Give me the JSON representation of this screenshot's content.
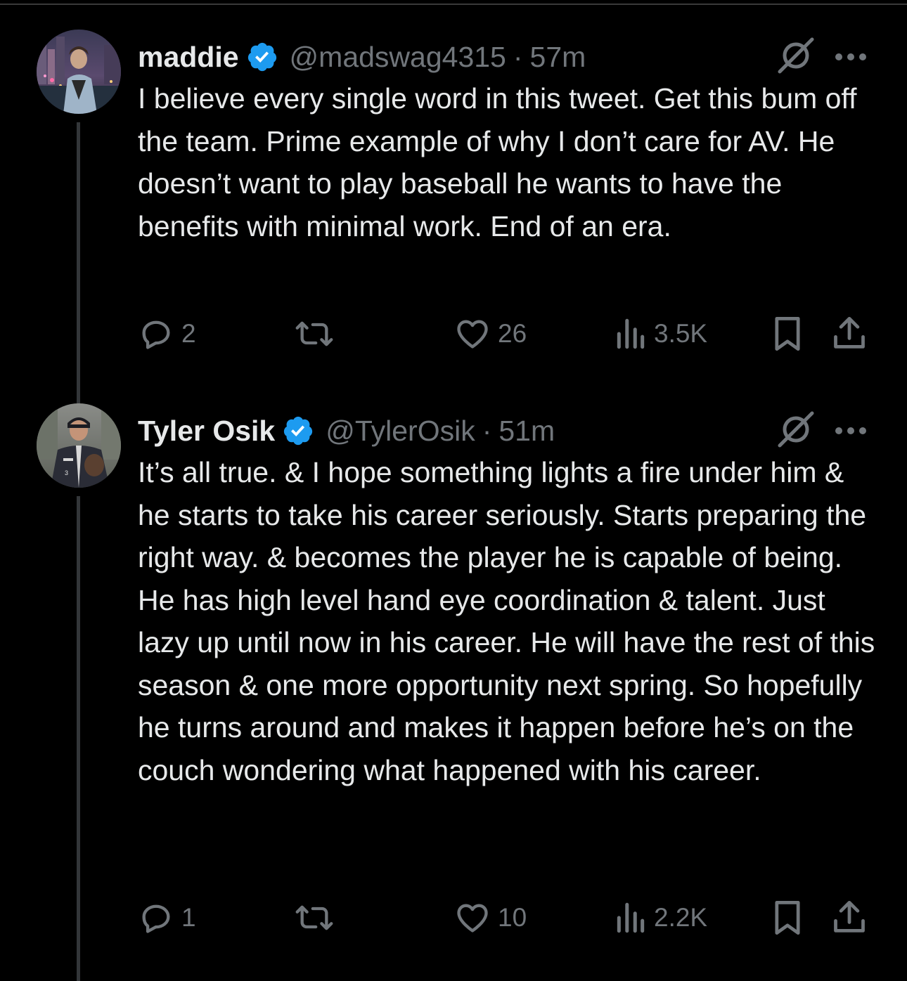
{
  "colors": {
    "background": "#000000",
    "text": "#e7e9ea",
    "secondary": "#71767b",
    "verified": "#1d9bf0",
    "divider": "#333639"
  },
  "tweets": [
    {
      "display_name": "maddie",
      "verified": true,
      "handle": "@madswag4315",
      "separator": "·",
      "time_ago": "57m",
      "text": "I believe every single word in this tweet. Get this bum off the team. Prime example of why I don’t care for AV. He doesn’t want to play baseball he wants to have the benefits with minimal work. End of an era.",
      "replies": "2",
      "retweets": "",
      "likes": "26",
      "views": "3.5K",
      "icons": [
        "reply-icon",
        "retweet-icon",
        "like-icon",
        "views-icon",
        "bookmark-icon",
        "share-icon",
        "grok-icon",
        "more-icon"
      ]
    },
    {
      "display_name": "Tyler Osik",
      "verified": true,
      "handle": "@TylerOsik",
      "separator": "·",
      "time_ago": "51m",
      "text": "It’s all true. & I hope something lights a fire under him & he starts to take his career seriously. Starts preparing the right way. & becomes the player he is capable of being. He has high level hand eye coordination & talent. Just lazy up until now in his career. He will have the rest of this season & one more opportunity next spring. So hopefully he turns around and makes it happen before he’s on the couch wondering what happened with his career.",
      "replies": "1",
      "retweets": "",
      "likes": "10",
      "views": "2.2K",
      "icons": [
        "reply-icon",
        "retweet-icon",
        "like-icon",
        "views-icon",
        "bookmark-icon",
        "share-icon",
        "grok-icon",
        "more-icon"
      ]
    }
  ]
}
